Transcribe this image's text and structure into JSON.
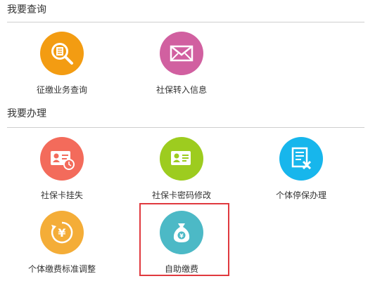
{
  "sections": {
    "query": {
      "title": "我要查询"
    },
    "handle": {
      "title": "我要办理"
    }
  },
  "query_items": [
    {
      "label": "征缴业务查询",
      "icon": "document-search-icon",
      "color": "#f39c12"
    },
    {
      "label": "社保转入信息",
      "icon": "envelope-icon",
      "color": "#d160a0"
    }
  ],
  "handle_items": [
    {
      "label": "社保卡挂失",
      "icon": "id-card-clock-icon",
      "color": "#f36b5b"
    },
    {
      "label": "社保卡密码修改",
      "icon": "id-card-edit-icon",
      "color": "#9dcc1f"
    },
    {
      "label": "个体停保办理",
      "icon": "document-cross-icon",
      "color": "#17b6ec"
    },
    {
      "label": "个体缴费标准调整",
      "icon": "yuan-cycle-icon",
      "color": "#f4ad38"
    },
    {
      "label": "自助缴费",
      "icon": "money-bag-icon",
      "color": "#4cb9c6"
    }
  ],
  "highlighted_item": "自助缴费",
  "highlight_color": "#e0393e"
}
